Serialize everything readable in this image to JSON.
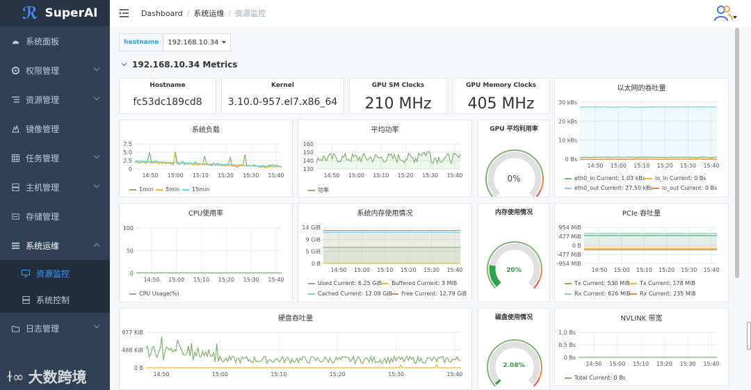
{
  "app": {
    "name": "SuperAI",
    "watermark": "大数跨境"
  },
  "sidebar": {
    "items": [
      {
        "label": "系统面板"
      },
      {
        "label": "权限管理"
      },
      {
        "label": "资源管理"
      },
      {
        "label": "镜像管理"
      },
      {
        "label": "任务管理"
      },
      {
        "label": "主机管理"
      },
      {
        "label": "存储管理"
      },
      {
        "label": "系统运维"
      },
      {
        "label": "日志管理"
      }
    ],
    "subitems": [
      {
        "label": "资源监控",
        "active": true
      },
      {
        "label": "系统控制",
        "active": false
      }
    ]
  },
  "breadcrumb": {
    "items": [
      "Dashboard",
      "系统运维",
      "资源监控"
    ],
    "sep": "/"
  },
  "variable": {
    "label": "hostname",
    "value": "192.168.10.34"
  },
  "row": {
    "title": "192.168.10.34 Metrics"
  },
  "colors": {
    "green": "#7eb26d",
    "yellow": "#eab839",
    "cyan": "#6ed0e0",
    "orange": "#ef843c",
    "red": "#e24d42",
    "sidebar": "#304156",
    "accent": "#409eff"
  },
  "panels": {
    "hostname": {
      "title": "Hostname",
      "value": "fc53dc189cd8"
    },
    "kernel": {
      "title": "Kernel",
      "value": "3.10.0-957.el7.x86_64"
    },
    "gpu_sm": {
      "title": "GPU SM Clocks",
      "value": "210 MHz"
    },
    "gpu_mem": {
      "title": "GPU Memory Clocks",
      "value": "405 MHz"
    },
    "gpu_util": {
      "title": "GPU 平均利用率",
      "value": "0%",
      "fraction": 0
    },
    "mem_usage": {
      "title": "内存使用情况",
      "value": "20%",
      "fraction": 0.2
    },
    "disk_usage": {
      "title": "磁盘使用情况",
      "value": "2.08%",
      "fraction": 0.0208
    }
  },
  "chart_data": [
    {
      "id": "load",
      "type": "line",
      "title": "系统负载",
      "x": [
        "14:50",
        "15:00",
        "15:10",
        "15:20",
        "15:30",
        "15:40"
      ],
      "yticks": [
        "7.5",
        "5.0",
        "2.5",
        "0"
      ],
      "ylim": [
        0,
        8
      ],
      "series": [
        {
          "name": "1min"
        },
        {
          "name": "5min"
        },
        {
          "name": "15min"
        }
      ]
    },
    {
      "id": "power",
      "type": "area",
      "title": "平均功率",
      "x": [
        "14:50",
        "15:00",
        "15:10",
        "15:20",
        "15:30",
        "15:40"
      ],
      "yticks": [
        "160",
        "150",
        "140",
        "130"
      ],
      "ylim": [
        130,
        160
      ],
      "series": [
        {
          "name": "功率"
        }
      ]
    },
    {
      "id": "eth",
      "type": "line",
      "title": "以太网的吞吐量",
      "x": [
        "14:50",
        "15:00",
        "15:10",
        "15:20",
        "15:30",
        "15:40"
      ],
      "yticks": [
        "30 kBs",
        "20 kBs",
        "10 kBs",
        "0 Bs"
      ],
      "series": [
        {
          "name": "eth0_in",
          "current": "1.03 kBs"
        },
        {
          "name": "lo_in",
          "current": "0 Bs"
        },
        {
          "name": "eth0_out",
          "current": "27.50 kBs"
        },
        {
          "name": "lo_out",
          "current": "0 Bs"
        }
      ]
    },
    {
      "id": "cpu",
      "type": "line",
      "title": "CPU使用率",
      "x": [
        "14:50",
        "15:00",
        "15:10",
        "15:20",
        "15:30",
        "15:40"
      ],
      "yticks": [
        "100",
        "50",
        "0"
      ],
      "ylim": [
        0,
        100
      ],
      "series": [
        {
          "name": "CPU Usage(%)"
        }
      ]
    },
    {
      "id": "mem",
      "type": "line",
      "title": "系统内存使用情况",
      "x": [
        "14:50",
        "15:00",
        "15:10",
        "15:20",
        "15:30",
        "15:40"
      ],
      "yticks": [
        "14 GiB",
        "9 GiB",
        "5 GiB",
        "0 B"
      ],
      "series": [
        {
          "name": "Used",
          "current": "6.25 GiB"
        },
        {
          "name": "Buffered",
          "current": "3 MiB"
        },
        {
          "name": "Cached",
          "current": "12.09 GiB"
        },
        {
          "name": "Free",
          "current": "12.79 GiB"
        }
      ]
    },
    {
      "id": "pcie",
      "type": "line",
      "title": "PCIe 吞吐量",
      "x": [
        "14:50",
        "15:00",
        "15:10",
        "15:20",
        "15:30",
        "15:40"
      ],
      "yticks": [
        "954 MiB",
        "477 MiB",
        "0 B",
        "-477 MiB",
        "-954 MiB"
      ],
      "series": [
        {
          "name": "Tx",
          "current": "530 MiB"
        },
        {
          "name": "Tx",
          "current": "178 MiB"
        },
        {
          "name": "Rx",
          "current": "626 MiB"
        },
        {
          "name": "Rx",
          "current": "235 MiB"
        }
      ]
    },
    {
      "id": "disk",
      "type": "line",
      "title": "硬盘吞吐量",
      "x": [
        "14:50",
        "15:00",
        "15:10",
        "15:20",
        "15:30",
        "15:40"
      ],
      "yticks": [
        "977 KiB",
        "488 KiB",
        "0 B"
      ],
      "series": []
    },
    {
      "id": "nvlink",
      "type": "line",
      "title": "NVLINK 带宽",
      "x": [
        "14:50",
        "15:00",
        "15:10",
        "15:20",
        "15:30",
        "15:40"
      ],
      "yticks": [
        "1.0 Bs",
        "0.5 Bs",
        "0 Bs"
      ],
      "series": [
        {
          "name": "Total",
          "current": "0 Bs"
        }
      ]
    }
  ]
}
